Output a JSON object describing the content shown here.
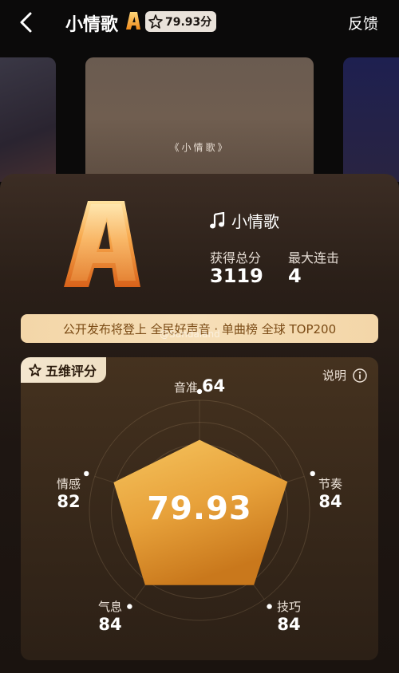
{
  "header": {
    "title": "小情歌",
    "grade": "A",
    "score_chip": "79.93分",
    "feedback_label": "反馈"
  },
  "carousel": {
    "center_song_tag": "《小情歌》"
  },
  "result": {
    "grade": "A",
    "song_name": "小情歌",
    "total_score_label": "获得总分",
    "total_score": "3119",
    "max_combo_label": "最大连击",
    "max_combo": "4",
    "banner_text": "公开发布将登上 全民好声音 · 单曲榜 全球 TOP200",
    "watermark": "@Sundaland"
  },
  "radar": {
    "tag_label": "五维评分",
    "explain_label": "说明",
    "overall_score": "79.93",
    "max_value": 100,
    "dimensions": [
      {
        "name": "音准",
        "value": 64
      },
      {
        "name": "节奏",
        "value": 84
      },
      {
        "name": "技巧",
        "value": 84
      },
      {
        "name": "气息",
        "value": 84
      },
      {
        "name": "情感",
        "value": 82
      }
    ]
  },
  "colors": {
    "gold": "#f2b84a",
    "banner_bg": "#f4d9ac",
    "banner_text": "#7a4a14"
  }
}
